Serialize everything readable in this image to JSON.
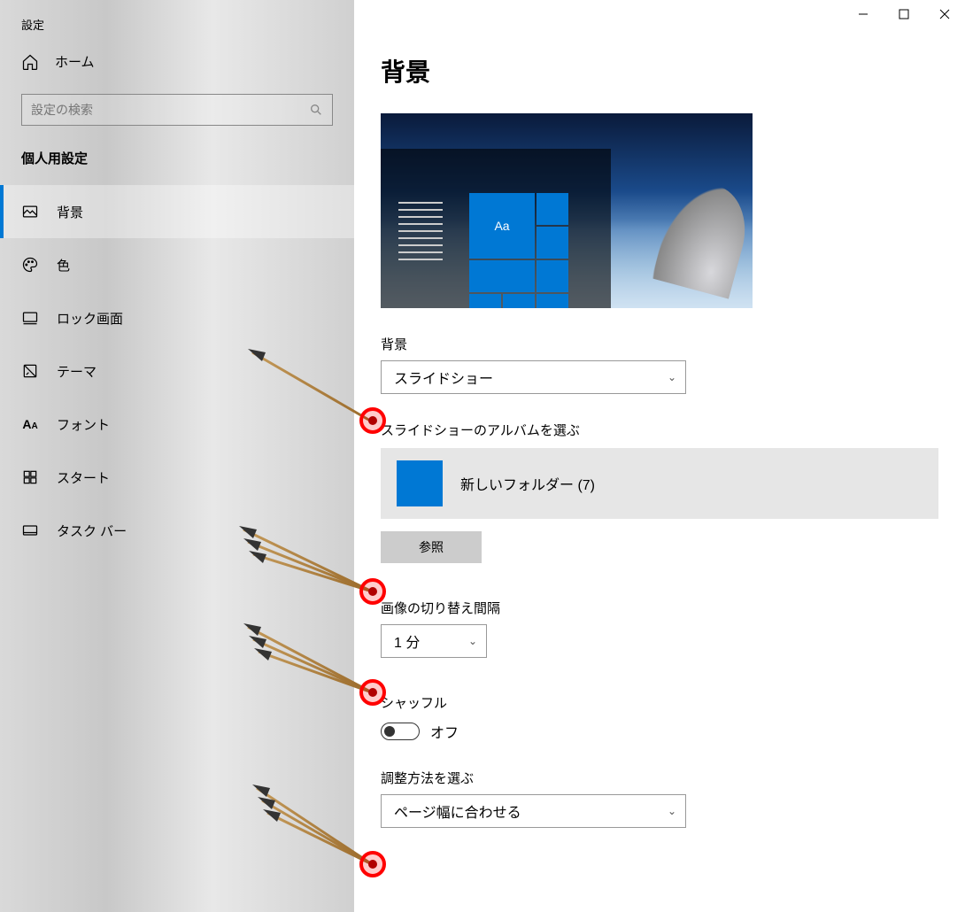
{
  "window": {
    "title": "設定"
  },
  "sidebar": {
    "home_label": "ホーム",
    "search_placeholder": "設定の検索",
    "category_title": "個人用設定",
    "items": [
      {
        "label": "背景",
        "icon": "picture",
        "active": true
      },
      {
        "label": "色",
        "icon": "palette",
        "active": false
      },
      {
        "label": "ロック画面",
        "icon": "lock-screen",
        "active": false
      },
      {
        "label": "テーマ",
        "icon": "theme",
        "active": false
      },
      {
        "label": "フォント",
        "icon": "font",
        "active": false
      },
      {
        "label": "スタート",
        "icon": "start",
        "active": false
      },
      {
        "label": "タスク バー",
        "icon": "taskbar",
        "active": false
      }
    ]
  },
  "main": {
    "page_title": "背景",
    "preview_text": "Aa",
    "background_label": "背景",
    "background_value": "スライドショー",
    "album_label": "スライドショーのアルバムを選ぶ",
    "album_folder": "新しいフォルダー (7)",
    "browse_label": "参照",
    "interval_label": "画像の切り替え間隔",
    "interval_value": "1 分",
    "shuffle_label": "シャッフル",
    "shuffle_state": "オフ",
    "fit_label": "調整方法を選ぶ",
    "fit_value": "ページ幅に合わせる"
  }
}
